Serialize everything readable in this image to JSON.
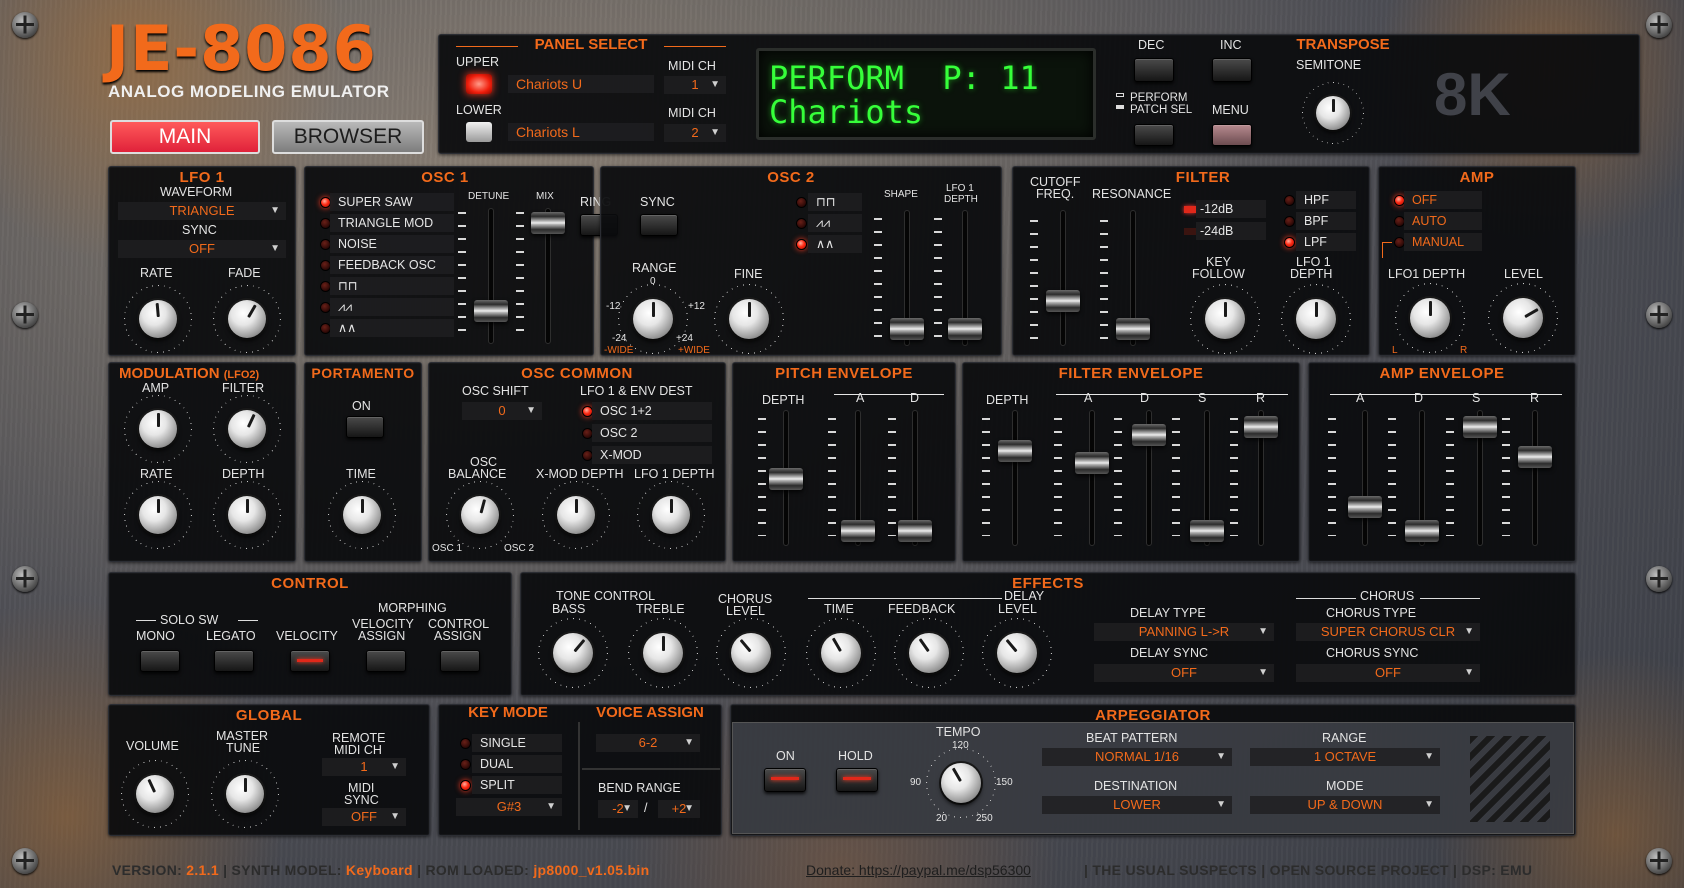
{
  "brand": {
    "title": "JE-8086",
    "subtitle": "ANALOG MODELING EMULATOR",
    "corner_logo": "8K"
  },
  "nav": {
    "main": "MAIN",
    "browser": "BROWSER"
  },
  "panel_select": {
    "title": "PANEL SELECT",
    "upper_label": "UPPER",
    "lower_label": "LOWER",
    "upper_patch": "Chariots U",
    "lower_patch": "Chariots L",
    "midi_ch_label": "MIDI CH",
    "upper_midi": "1",
    "lower_midi": "2"
  },
  "display": {
    "line1": "PERFORM  P: 11",
    "line2": "Chariots"
  },
  "header_buttons": {
    "dec": "DEC",
    "inc": "INC",
    "perform": "PERFORM",
    "patch_sel": "PATCH SEL",
    "menu": "MENU"
  },
  "transpose": {
    "title": "TRANSPOSE",
    "semitone": "SEMITONE"
  },
  "lfo1": {
    "title": "LFO 1",
    "waveform_label": "WAVEFORM",
    "waveform": "TRIANGLE",
    "sync_label": "SYNC",
    "sync": "OFF",
    "rate": "RATE",
    "fade": "FADE"
  },
  "osc1": {
    "title": "OSC 1",
    "detune": "DETUNE",
    "mix": "MIX",
    "ring": "RING",
    "sync": "SYNC",
    "waves": [
      "SUPER SAW",
      "TRIANGLE MOD",
      "NOISE",
      "FEEDBACK OSC"
    ]
  },
  "osc2": {
    "title": "OSC 2",
    "range": "RANGE",
    "fine": "FINE",
    "shape": "SHAPE",
    "lfo1_depth_1": "LFO 1",
    "lfo1_depth_2": "DEPTH",
    "range_marks": {
      "zero": "0",
      "m12": "-12",
      "p12": "+12",
      "m24": "-24",
      "p24": "+24",
      "wide_l": "-WIDE",
      "wide_r": "+WIDE"
    }
  },
  "filter": {
    "title": "FILTER",
    "cutoff_1": "CUTOFF",
    "cutoff_2": "FREQ.",
    "resonance": "RESONANCE",
    "slopes": [
      "-12dB",
      "-24dB"
    ],
    "types": [
      "HPF",
      "BPF",
      "LPF"
    ],
    "key_follow_1": "KEY",
    "key_follow_2": "FOLLOW",
    "lfo_depth_1": "LFO 1",
    "lfo_depth_2": "DEPTH"
  },
  "amp": {
    "title": "AMP",
    "modes": [
      "OFF",
      "AUTO",
      "MANUAL"
    ],
    "lfo1_depth": "LFO1 DEPTH",
    "level": "LEVEL",
    "l": "L",
    "r": "R"
  },
  "modulation": {
    "title": "MODULATION",
    "sub": "(LFO2)",
    "amp": "AMP",
    "filter": "FILTER",
    "rate": "RATE",
    "depth": "DEPTH"
  },
  "portamento": {
    "title": "PORTAMENTO",
    "on": "ON",
    "time": "TIME"
  },
  "osc_common": {
    "title": "OSC COMMON",
    "osc_shift": "OSC SHIFT",
    "osc_shift_value": "0",
    "dest_title": "LFO 1 & ENV DEST",
    "dests": [
      "OSC 1+2",
      "OSC 2",
      "X-MOD"
    ],
    "osc_balance_1": "OSC",
    "osc_balance_2": "BALANCE",
    "xmod_depth": "X-MOD DEPTH",
    "lfo1_depth": "LFO 1 DEPTH",
    "osc1_mark": "OSC 1",
    "osc2_mark": "OSC 2"
  },
  "pitch_env": {
    "title": "PITCH ENVELOPE",
    "depth": "DEPTH",
    "a": "A",
    "d": "D"
  },
  "filter_env": {
    "title": "FILTER ENVELOPE",
    "depth": "DEPTH",
    "a": "A",
    "d": "D",
    "s": "S",
    "r": "R"
  },
  "amp_env": {
    "title": "AMP ENVELOPE",
    "a": "A",
    "d": "D",
    "s": "S",
    "r": "R"
  },
  "control": {
    "title": "CONTROL",
    "solo_sw": "SOLO SW",
    "mono": "MONO",
    "legato": "LEGATO",
    "velocity": "VELOCITY",
    "morphing": "MORPHING",
    "vel_assign_1": "VELOCITY",
    "vel_assign_2": "ASSIGN",
    "ctrl_assign_1": "CONTROL",
    "ctrl_assign_2": "ASSIGN"
  },
  "effects": {
    "title": "EFFECTS",
    "tone_control": "TONE CONTROL",
    "bass": "BASS",
    "treble": "TREBLE",
    "chorus_level_1": "CHORUS",
    "chorus_level_2": "LEVEL",
    "delay": "DELAY",
    "time": "TIME",
    "feedback": "FEEDBACK",
    "delay_level": "LEVEL",
    "delay_type_label": "DELAY TYPE",
    "delay_type": "PANNING L->R",
    "delay_sync_label": "DELAY SYNC",
    "delay_sync": "OFF",
    "chorus": "CHORUS",
    "chorus_type_label": "CHORUS TYPE",
    "chorus_type": "SUPER CHORUS CLR",
    "chorus_sync_label": "CHORUS SYNC",
    "chorus_sync": "OFF"
  },
  "global": {
    "title": "GLOBAL",
    "volume": "VOLUME",
    "master_tune_1": "MASTER",
    "master_tune_2": "TUNE",
    "remote_midi_1": "REMOTE",
    "remote_midi_2": "MIDI CH",
    "remote_midi": "1",
    "midi_sync_1": "MIDI",
    "midi_sync_2": "SYNC",
    "midi_sync": "OFF"
  },
  "key_mode": {
    "title": "KEY MODE",
    "modes": [
      "SINGLE",
      "DUAL",
      "SPLIT"
    ],
    "split_point": "G#3"
  },
  "voice_assign": {
    "title": "VOICE ASSIGN",
    "value": "6-2",
    "bend_label": "BEND RANGE",
    "bend_down": "-2",
    "bend_sep": "/",
    "bend_up": "+2"
  },
  "arpeggiator": {
    "title": "ARPEGGIATOR",
    "on": "ON",
    "hold": "HOLD",
    "tempo": "TEMPO",
    "tempo_marks": {
      "t120": "120",
      "t90": "90",
      "t150": "150",
      "t20": "20",
      "t250": "250"
    },
    "beat_pattern_label": "BEAT PATTERN",
    "beat_pattern": "NORMAL 1/16",
    "range_label": "RANGE",
    "range": "1 OCTAVE",
    "destination_label": "DESTINATION",
    "destination": "LOWER",
    "mode_label": "MODE",
    "mode": "UP & DOWN"
  },
  "footer": {
    "version_label": "VERSION:",
    "version": "2.1.1",
    "synth_model_label": "SYNTH MODEL:",
    "synth_model": "Keyboard",
    "rom_label": "ROM LOADED:",
    "rom": "jp8000_v1.05.bin",
    "donate": "Donate: https://paypal.me/dsp56300",
    "credits": "THE USUAL SUSPECTS",
    "open_source": "OPEN SOURCE PROJECT",
    "dsp": "DSP: EMU"
  },
  "colors": {
    "accent": "#f26a1b",
    "panel": "#0b0c0e",
    "lcd_text": "#36ff3a",
    "led_red": "#ff2a14"
  }
}
